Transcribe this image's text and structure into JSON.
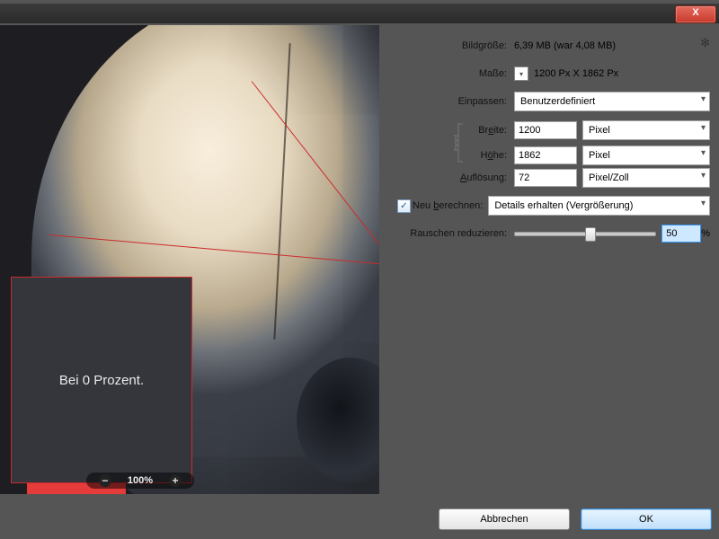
{
  "titlebar": {
    "close": "X"
  },
  "gear": "✻",
  "info": {
    "size_label": "Bildgröße:",
    "size_value": "6,39 MB (war 4,08 MB)",
    "dims_label": "Maße:",
    "dims_value": "1200 Px  X  1862 Px",
    "fit_label": "Einpassen:",
    "fit_value": "Benutzerdefiniert"
  },
  "width": {
    "label": "Breite:",
    "value": "1200",
    "unit": "Pixel"
  },
  "height": {
    "label": "Höhe:",
    "value": "1862",
    "unit": "Pixel"
  },
  "res": {
    "label": "Auflösung:",
    "value": "72",
    "unit": "Pixel/Zoll"
  },
  "resample": {
    "chk_label_pre": "Neu ",
    "chk_label_u": "b",
    "chk_label_post": "erechnen:",
    "method": "Details erhalten (Vergrößerung)"
  },
  "noise": {
    "label": "Rauschen reduzieren:",
    "value": "50",
    "pct": "%",
    "pos": 50
  },
  "inset_caption": "Bei 0 Prozent.",
  "zoom": {
    "out": "−",
    "level": "100%",
    "in": "+"
  },
  "buttons": {
    "cancel": "Abbrechen",
    "ok": "OK"
  },
  "width_u": "e",
  "height_u": "ö",
  "res_u": "A"
}
